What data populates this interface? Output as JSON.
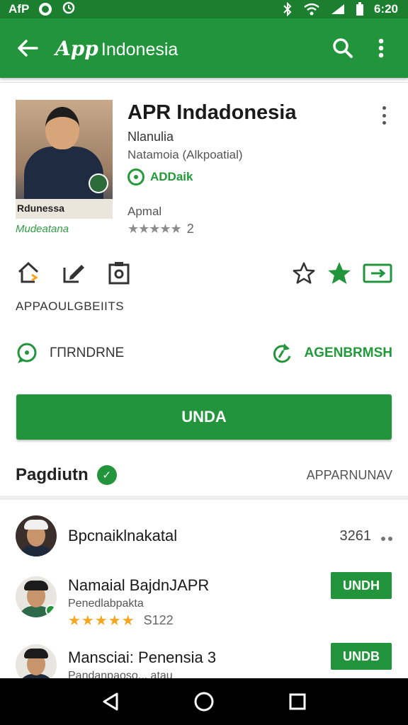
{
  "status_bar": {
    "carrier": "AfP",
    "time": "6:20"
  },
  "app_bar": {
    "title_logo": "App",
    "title_text": "Indonesia"
  },
  "app": {
    "name": "APR Indadonesia",
    "developer": "Nlanulia",
    "category": "Natamoia (Alkpoatial)",
    "installed_label": "ADDaik",
    "thumbnail_caption": "Rdunessa",
    "thumbnail_subcaption": "Mudeatana",
    "rating_label": "Apmal",
    "rating_stars": "★★★★★",
    "rating_count": "2",
    "action_label": "APPAOULGBEIITS",
    "left_link": "ГПRNDRNE",
    "right_link": "AGENBRMSH",
    "install_button": "UNDA",
    "accent_color": "#22953c"
  },
  "section": {
    "title": "Pagdiutn",
    "check": "✓",
    "more_link": "APPARNUNAV"
  },
  "list": [
    {
      "title": "Bpcnaiklnakatal",
      "count": "3261"
    },
    {
      "title": "Namaial BajdnJAPR",
      "subtitle": "Penedlabpakta",
      "stars": "★★★★★",
      "rating": "S122",
      "button": "UNDH"
    },
    {
      "title": "Mansciai: Penensia 3",
      "subtitle": "Pandanpaoso... atau",
      "button": "UNDB"
    }
  ]
}
